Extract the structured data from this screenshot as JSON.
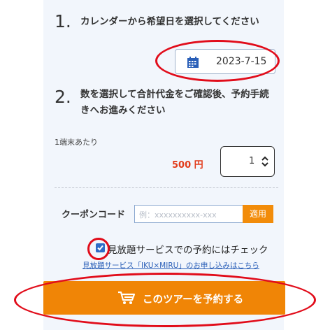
{
  "steps": [
    {
      "number": "1.",
      "text": "カレンダーから希望日を選択してください"
    },
    {
      "number": "2.",
      "text": "数を選択して合計代金をご確認後、予約手続きへお進みください"
    }
  ],
  "date": {
    "value": "2023-7-15",
    "icon": "calendar-icon"
  },
  "pricing": {
    "per_unit_label": "1端末あたり",
    "price": "500 円",
    "quantity": "1"
  },
  "coupon": {
    "label": "クーポンコード",
    "placeholder": "例：xxxxxxxxxx-xxx",
    "apply_label": "適用"
  },
  "subscription": {
    "checked": true,
    "label": "見放題サービスでの予約にはチェック",
    "link": "見放題サービス「IKU×MIRU」のお申し込みはこちら"
  },
  "booking": {
    "button_label": "このツアーを予約する",
    "icon": "cart-icon"
  },
  "colors": {
    "panel_bg": "#f2f6fc",
    "accent_orange": "#f08506",
    "annotation_red": "#e10c1a",
    "price_red": "#e23b1a",
    "link_blue": "#2a5fb8"
  }
}
